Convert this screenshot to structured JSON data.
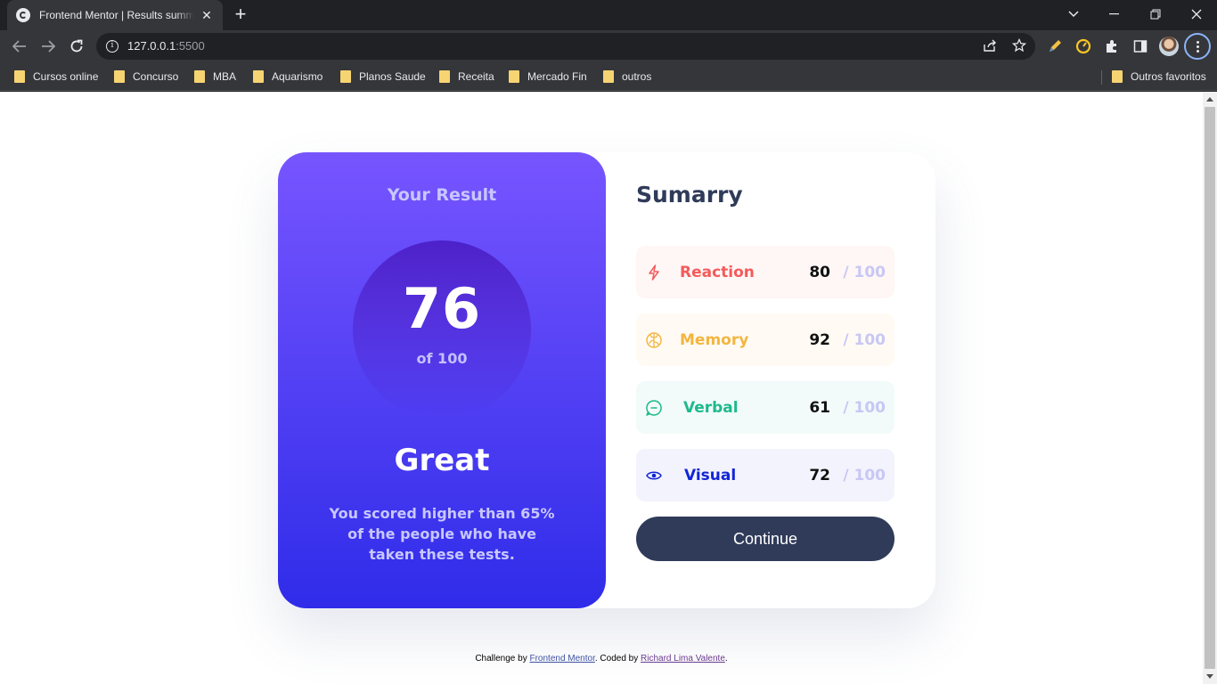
{
  "browser": {
    "tab": {
      "title": "Frontend Mentor | Results summary component"
    },
    "omnibox": {
      "host": "127.0.0.1",
      "port": ":5500"
    },
    "bookmarks": [
      "Cursos online",
      "Concurso",
      "MBA",
      "Aquarismo",
      "Planos Saude",
      "Receita",
      "Mercado Fin",
      "outros"
    ],
    "other_bookmarks": "Outros favoritos"
  },
  "result": {
    "title": "Your Result",
    "score": "76",
    "of": "of 100",
    "rating": "Great",
    "description": "You scored higher than 65% of the people who have taken these tests."
  },
  "summary": {
    "title": "Sumarry",
    "items": [
      {
        "label": "Reaction",
        "value": "80",
        "max": "/ 100",
        "icon": "lightning-icon",
        "color": "#f55a5a",
        "bg": "#fff6f6"
      },
      {
        "label": "Memory",
        "value": "92",
        "max": "/ 100",
        "icon": "brain-icon",
        "color": "#f4b53f",
        "bg": "#fffbf4"
      },
      {
        "label": "Verbal",
        "value": "61",
        "max": "/ 100",
        "icon": "chat-bubble-icon",
        "color": "#1eb98c",
        "bg": "#f2fbfa"
      },
      {
        "label": "Visual",
        "value": "72",
        "max": "/ 100",
        "icon": "eye-icon",
        "color": "#1125d6",
        "bg": "#f3f3fd"
      }
    ],
    "button": "Continue"
  },
  "attribution": {
    "prefix": "Challenge by",
    "link1": "Frontend Mentor",
    "middle": ". Coded by",
    "link2": "Richard Lima Valente",
    "suffix": "."
  }
}
